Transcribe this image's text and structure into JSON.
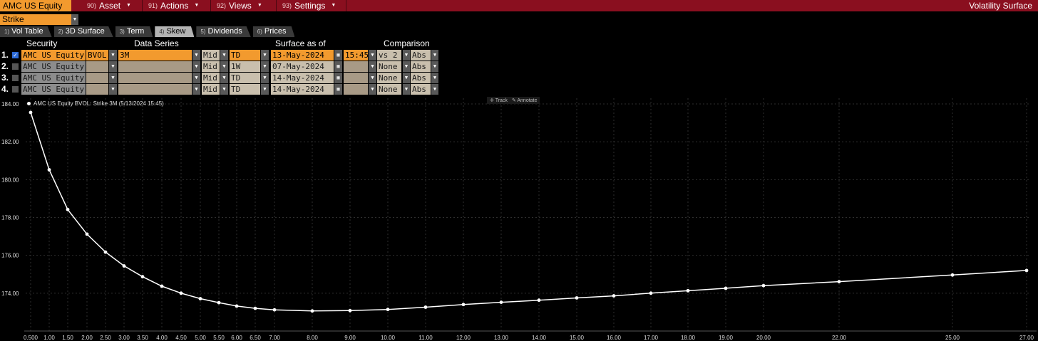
{
  "topbar": {
    "ticker": "AMC US Equity",
    "menus": [
      {
        "num": "90)",
        "label": "Asset"
      },
      {
        "num": "91)",
        "label": "Actions"
      },
      {
        "num": "92)",
        "label": "Views"
      },
      {
        "num": "93)",
        "label": "Settings"
      }
    ],
    "title": "Volatility Surface"
  },
  "strike_select": "Strike",
  "tabs": [
    {
      "num": "1)",
      "label": "Vol Table",
      "active": false
    },
    {
      "num": "2)",
      "label": "3D Surface",
      "active": false
    },
    {
      "num": "3)",
      "label": "Term",
      "active": false
    },
    {
      "num": "4)",
      "label": "Skew",
      "active": true
    },
    {
      "num": "5)",
      "label": "Dividends",
      "active": false
    },
    {
      "num": "6)",
      "label": "Prices",
      "active": false
    }
  ],
  "grid": {
    "headers": {
      "security": "Security",
      "data_series": "Data Series",
      "surface": "Surface as of",
      "comparison": "Comparison"
    },
    "rows": [
      {
        "idx": "1.",
        "checked": true,
        "security": "AMC US Equity",
        "src": "BVOL",
        "series": "3M",
        "side": "Mid",
        "rel": "TD",
        "date": "13-May-2024",
        "time": "15:45",
        "cmp": "vs 2",
        "mode": "Abs"
      },
      {
        "idx": "2.",
        "checked": false,
        "security": "AMC US Equity",
        "src": "",
        "series": "",
        "side": "Mid",
        "rel": "1W",
        "date": "07-May-2024",
        "time": "",
        "cmp": "None",
        "mode": "Abs"
      },
      {
        "idx": "3.",
        "checked": false,
        "security": "AMC US Equity",
        "src": "",
        "series": "",
        "side": "Mid",
        "rel": "TD",
        "date": "14-May-2024",
        "time": "",
        "cmp": "None",
        "mode": "Abs"
      },
      {
        "idx": "4.",
        "checked": false,
        "security": "AMC US Equity",
        "src": "",
        "series": "",
        "side": "Mid",
        "rel": "TD",
        "date": "14-May-2024",
        "time": "",
        "cmp": "None",
        "mode": "Abs"
      }
    ]
  },
  "chart_tools": {
    "track": "Track",
    "annotate": "Annotate"
  },
  "chart_data": {
    "type": "line",
    "legend": "AMC US Equity BVOL: Strike 3M (5/13/2024 15:45)",
    "x_ticks": [
      "0.500",
      "1.00",
      "1.50",
      "2.00",
      "2.50",
      "3.00",
      "3.50",
      "4.00",
      "4.50",
      "5.00",
      "5.50",
      "6.00",
      "6.50",
      "7.00",
      "8.00",
      "9.00",
      "10.00",
      "11.00",
      "12.00",
      "13.00",
      "14.00",
      "15.00",
      "16.00",
      "17.00",
      "18.00",
      "19.00",
      "20.00",
      "22.00",
      "25.00",
      "27.00"
    ],
    "y_ticks": [
      "184.00",
      "182.00",
      "180.00",
      "178.00",
      "176.00",
      "174.00"
    ],
    "ylim": [
      172.0,
      184.3
    ],
    "series": [
      {
        "values": [
          183.55,
          180.52,
          178.42,
          177.12,
          176.17,
          175.44,
          174.87,
          174.37,
          174.0,
          173.71,
          173.5,
          173.32,
          173.2,
          173.12,
          173.06,
          173.08,
          173.14,
          173.26,
          173.4,
          173.52,
          173.63,
          173.75,
          173.86,
          174.0,
          174.13,
          174.26,
          174.4,
          174.61,
          174.96,
          175.2
        ]
      }
    ]
  }
}
